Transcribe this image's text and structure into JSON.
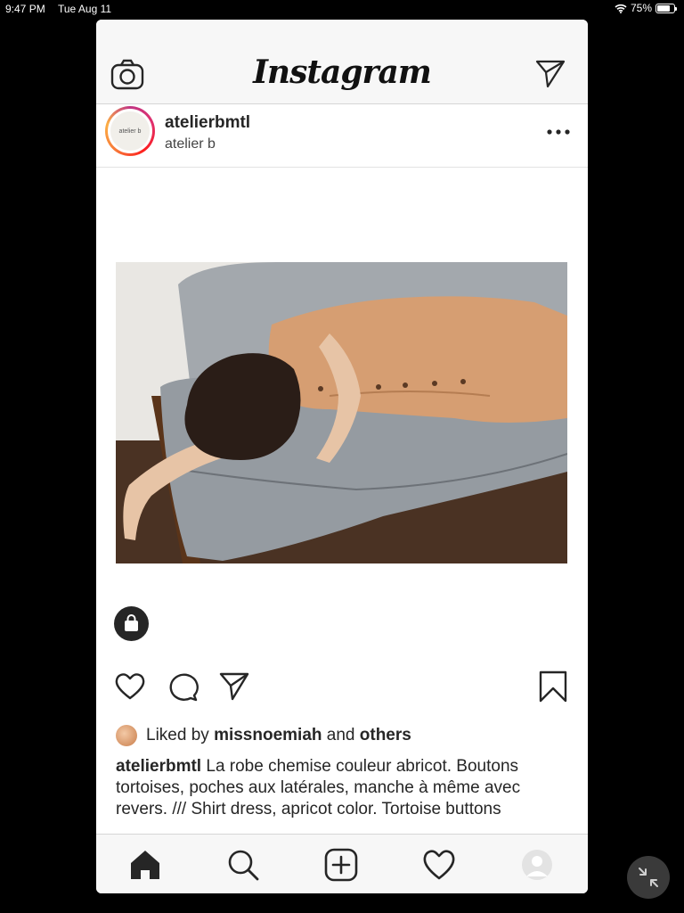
{
  "status_bar": {
    "time": "9:47 PM",
    "date": "Tue Aug 11",
    "battery": "75%",
    "battery_level": 0.75
  },
  "app": {
    "logo": "Instagram"
  },
  "icons": {
    "camera": "camera-icon",
    "direct": "paper-plane-icon",
    "more": "more-dots-icon",
    "shopping": "shopping-bag-icon",
    "like": "heart-icon",
    "comment": "comment-icon",
    "share": "paper-plane-icon",
    "save": "bookmark-icon",
    "home": "home-icon",
    "search": "search-icon",
    "new_post": "add-post-icon",
    "activity": "heart-icon",
    "profile": "profile-avatar-icon",
    "collapse": "collapse-arrows-icon"
  },
  "post": {
    "username": "atelierbmtl",
    "full_name": "atelier b",
    "avatar_text": "atelier b",
    "likes": {
      "prefix": "Liked by",
      "user": "missnoemiah",
      "middle": "and",
      "suffix": "others"
    },
    "caption": {
      "username": "atelierbmtl",
      "text": " La robe chemise couleur abricot. Boutons tortoises, poches aux latérales, manche à même avec revers. /// Shirt dress, apricot color. Tortoise buttons"
    }
  },
  "colors": {
    "dress": "#d9a074",
    "sofa": "#9ea4aa",
    "ring_start": "#c13584",
    "ring_end": "#fcaf45"
  }
}
